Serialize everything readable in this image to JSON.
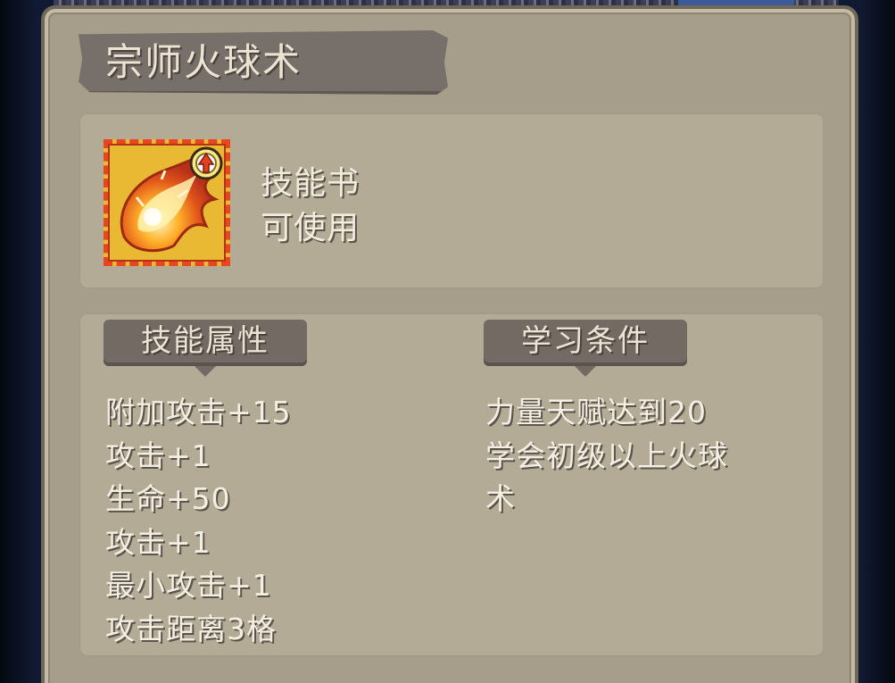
{
  "dialog": {
    "title": "宗师火球术"
  },
  "item": {
    "type": "技能书",
    "usable": "可使用",
    "icon": "fireball-skill-book-icon",
    "badge_icon": "upgrade-arrow-badge-icon"
  },
  "sections": {
    "attributes": {
      "label": "技能属性",
      "lines": [
        "附加攻击+15",
        "攻击+1",
        "生命+50",
        "攻击+1",
        "最小攻击+1",
        "攻击距离3格"
      ]
    },
    "requirements": {
      "label": "学习条件",
      "lines": [
        "力量天赋达到20",
        "学会初级以上火球",
        "术"
      ]
    }
  },
  "colors": {
    "panel": "#a69e8b",
    "card": "#b3ab96",
    "tag": "#726a63",
    "icon_border": "#e8461e",
    "icon_bg": "#e9b934",
    "text": "#f4efe2"
  }
}
